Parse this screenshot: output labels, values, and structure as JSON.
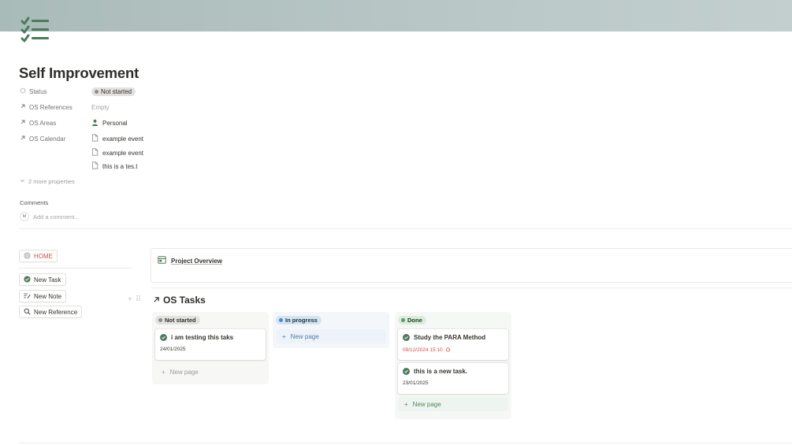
{
  "page": {
    "title": "Self Improvement",
    "icon": "checklist-icon",
    "accent_color": "#4d7a5c"
  },
  "properties": [
    {
      "label": "Status",
      "icon": "status-icon"
    },
    {
      "label": "OS References",
      "icon": "relation-arrow-icon"
    },
    {
      "label": "OS Areas",
      "icon": "relation-arrow-icon"
    },
    {
      "label": "OS Calendar",
      "icon": "relation-arrow-icon"
    }
  ],
  "values": {
    "status": "Not started",
    "references": "Empty",
    "areas": "Personal",
    "calendar": [
      "example event",
      "example event",
      "this is a tes.t"
    ]
  },
  "more_properties": "2 more properties",
  "comments": {
    "heading": "Comments",
    "avatar": "M",
    "placeholder": "Add a comment..."
  },
  "buttons": {
    "home": "HOME",
    "new_task": "New Task",
    "new_note": "New Note",
    "new_reference": "New Reference"
  },
  "overview": {
    "label": "Project Overview"
  },
  "board": {
    "title": "OS Tasks",
    "new_page_label": "New page",
    "columns": [
      {
        "name": "Not started",
        "color": "#9b9a97",
        "cards": [
          {
            "title": "i am testing this taks",
            "date": "24/01/2025"
          }
        ]
      },
      {
        "name": "In progress",
        "color": "#4e8ac8",
        "cards": []
      },
      {
        "name": "Done",
        "color": "#5a9b69",
        "cards": [
          {
            "title": "Study the PARA Method",
            "date": "09/12/2024 15:10",
            "overdue": true
          },
          {
            "title": "this is a new task.",
            "date": "23/01/2025"
          }
        ]
      }
    ]
  }
}
